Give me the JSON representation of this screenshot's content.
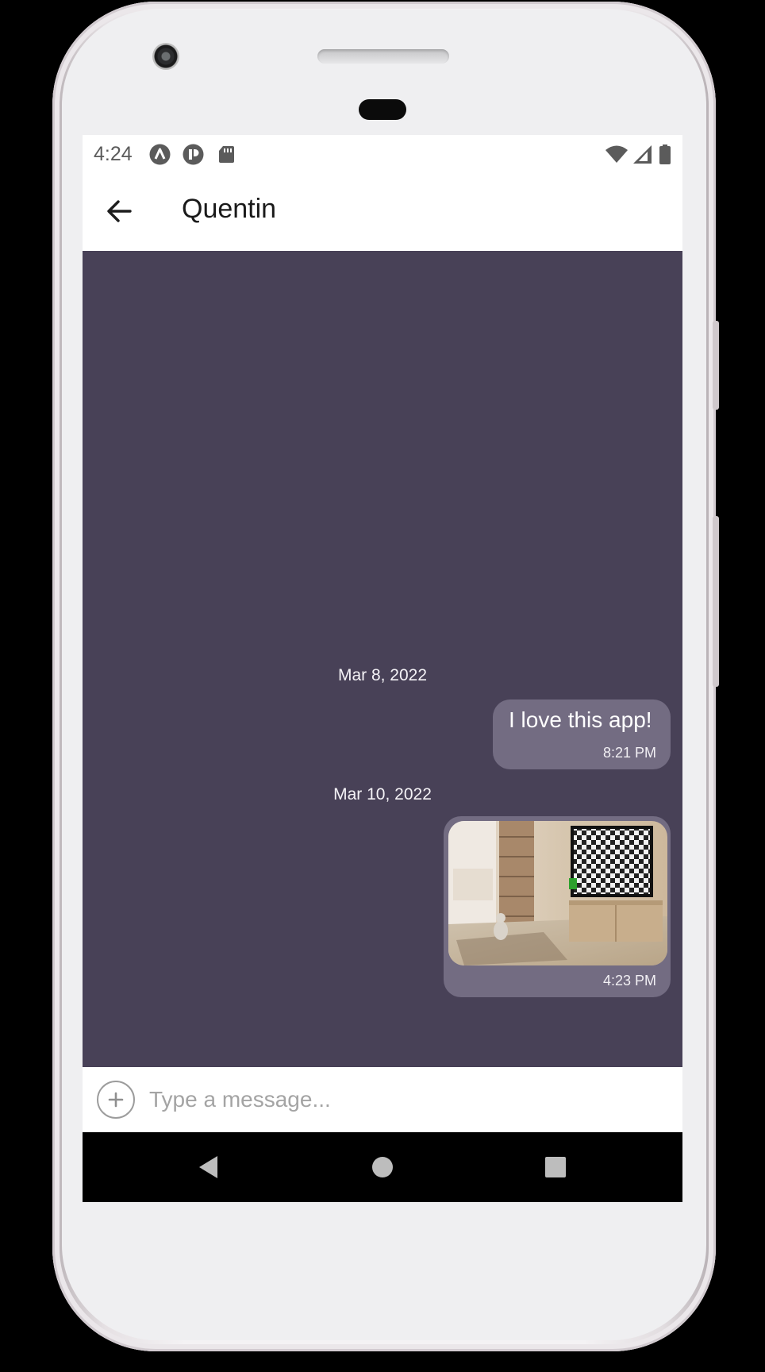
{
  "status_bar": {
    "time": "4:24",
    "left_icons": [
      "a-letter-icon",
      "p-app-icon",
      "sd-card-icon"
    ],
    "right_icons": [
      "wifi-icon",
      "signal-icon",
      "battery-icon"
    ]
  },
  "header": {
    "title": "Quentin",
    "back_icon": "arrow-left-icon"
  },
  "chat": {
    "background_color": "#484157",
    "bubble_color": "#736c82",
    "messages": [
      {
        "date_separator": "Mar 8, 2022",
        "text": "I love this app!",
        "time": "8:21 PM",
        "type": "text"
      },
      {
        "date_separator": "Mar 10, 2022",
        "time": "4:23 PM",
        "type": "image",
        "image_description_icon": "photo-icon"
      }
    ]
  },
  "composer": {
    "placeholder": "Type a message...",
    "attach_icon": "plus-circle-icon"
  },
  "navigation": {
    "back_icon": "nav-back-triangle-icon",
    "home_icon": "nav-home-circle-icon",
    "recents_icon": "nav-recents-square-icon"
  }
}
